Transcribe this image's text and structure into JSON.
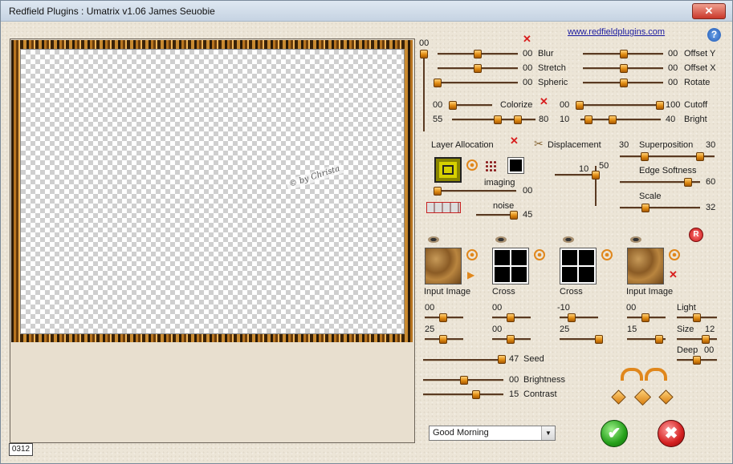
{
  "window": {
    "title": "Redfield Plugins : Umatrix v1.06   James Seuobie",
    "close_glyph": "✕"
  },
  "header": {
    "link": "www.redfieldplugins.com",
    "help": "?"
  },
  "preview": {
    "watermark": "© by Christa",
    "counter": "0312"
  },
  "top": {
    "vert_value": "00",
    "blur": {
      "label": "Blur",
      "value": "00"
    },
    "stretch": {
      "label": "Stretch",
      "value": "00"
    },
    "spheric": {
      "label": "Spheric",
      "value": "00"
    },
    "offsety": {
      "label": "Offset Y",
      "value": "00"
    },
    "offsetx": {
      "label": "Offset X",
      "value": "00"
    },
    "rotate": {
      "label": "Rotate",
      "value": "00"
    },
    "colorize": {
      "label": "Colorize",
      "value": "00"
    },
    "colorize_range": {
      "min": "55",
      "max": "80"
    },
    "cutoff": {
      "label": "Cutoff",
      "min": "00",
      "max": "100"
    },
    "bright": {
      "label": "Bright",
      "min": "10",
      "max": "40"
    }
  },
  "layer": {
    "label": "Layer Allocation",
    "imaging_label": "imaging",
    "imaging_value": "00",
    "noise_label": "noise",
    "noise_value": "45"
  },
  "displacement": {
    "label": "Displacement",
    "v1": "10",
    "v2": "50"
  },
  "superposition": {
    "label": "Superposition",
    "min": "30",
    "max": "30"
  },
  "edge_softness": {
    "label": "Edge Softness",
    "value": "60"
  },
  "scale": {
    "label": "Scale",
    "value": "32"
  },
  "thumbs": [
    {
      "label": "Input Image",
      "v1": "00",
      "v2": "25"
    },
    {
      "label": "Cross",
      "v1": "00",
      "v2": "00"
    },
    {
      "label": "Cross",
      "v1": "-10",
      "v2": "25"
    },
    {
      "label": "Input Image",
      "v1": "00",
      "v2": "15"
    }
  ],
  "light": {
    "label": "Light",
    "size_label": "Size",
    "size_value": "12",
    "deep_label": "Deep",
    "deep_value": "00"
  },
  "seed": {
    "label": "Seed",
    "value": "47"
  },
  "brightness": {
    "label": "Brightness",
    "value": "00"
  },
  "contrast": {
    "label": "Contrast",
    "value": "15"
  },
  "preset": {
    "value": "Good Morning"
  },
  "buttons": {
    "ok": "✔",
    "cancel": "✖",
    "reset": "R"
  },
  "colors": {
    "accent": "#e0871c",
    "cancel": "#d42020",
    "ok": "#25a01a"
  }
}
